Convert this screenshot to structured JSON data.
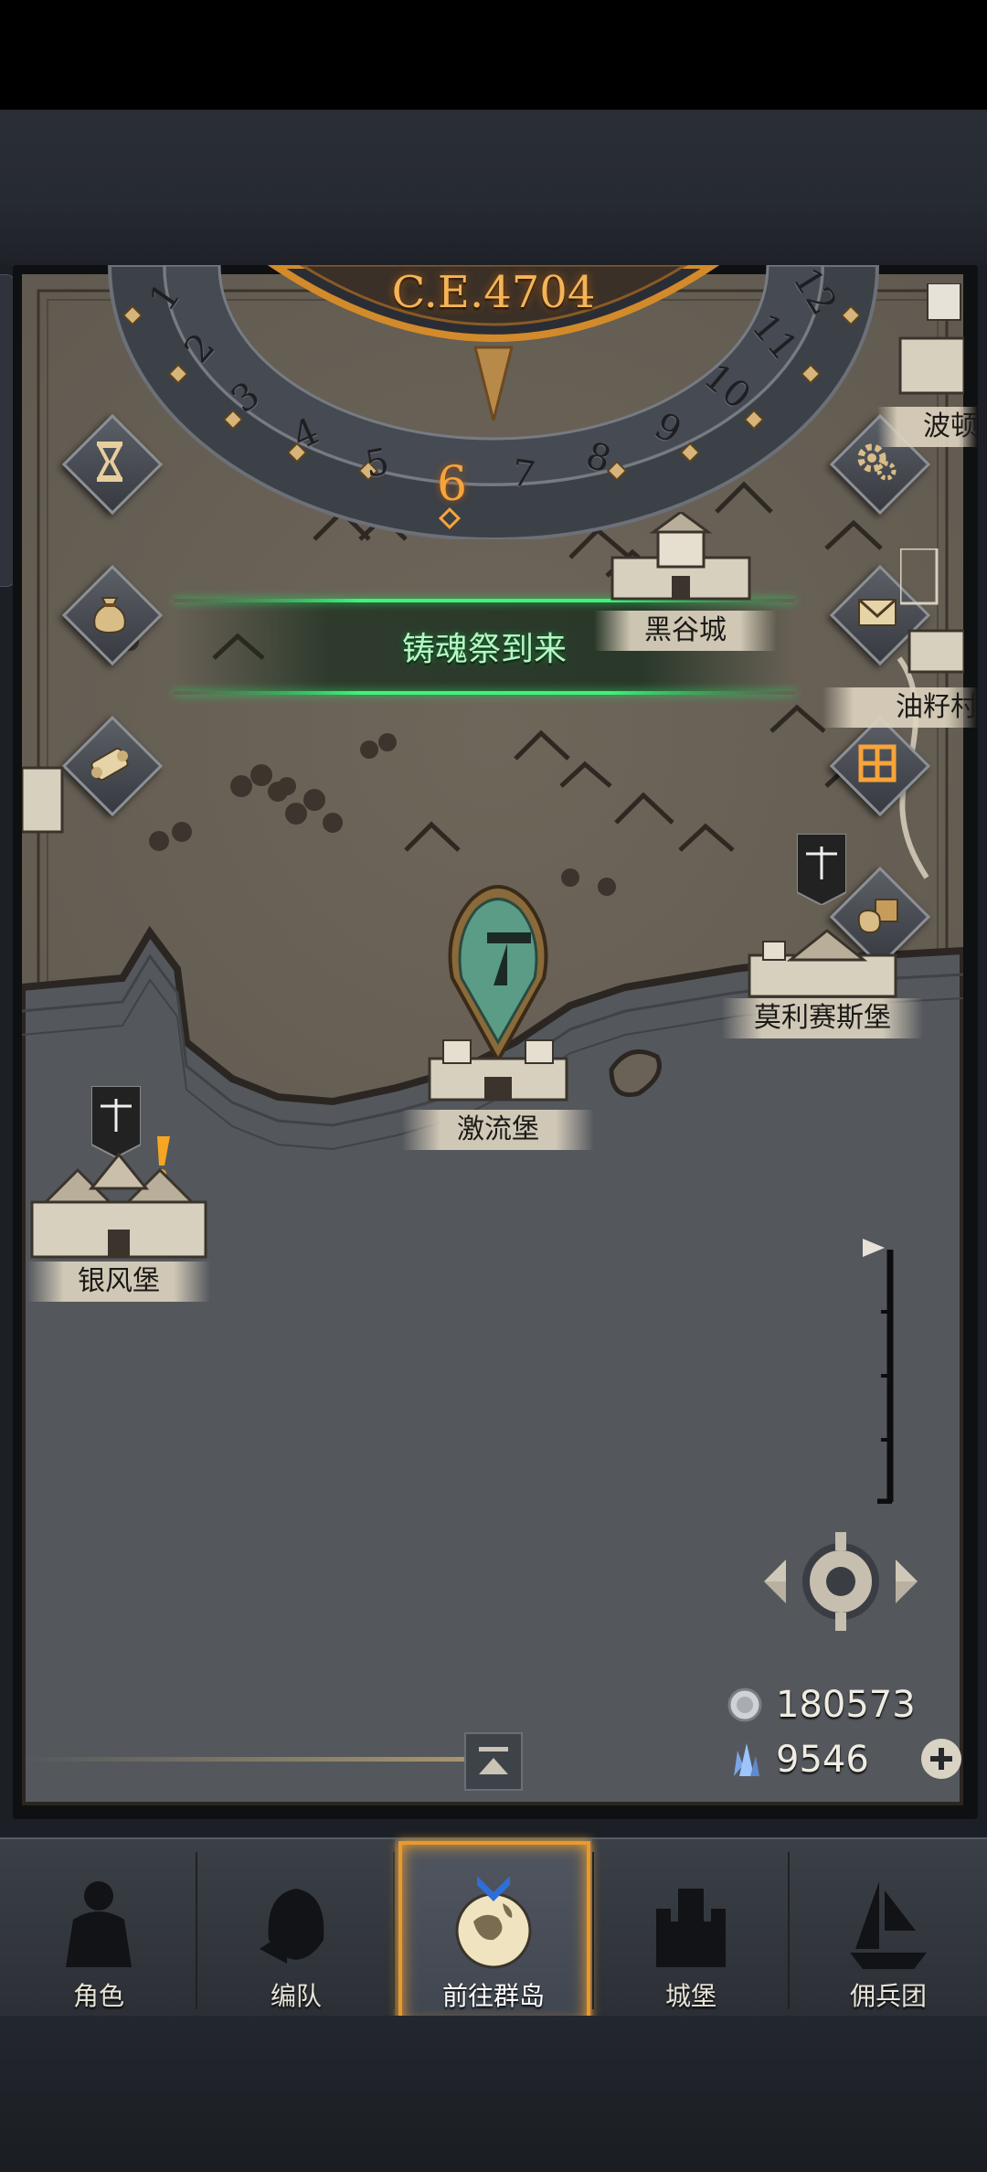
{
  "dial": {
    "year": "C.E.4704",
    "numbers": [
      "1",
      "2",
      "3",
      "4",
      "5",
      "6",
      "7",
      "8",
      "9",
      "10",
      "11",
      "12"
    ],
    "current": "6"
  },
  "event_banner": "铸魂祭到来",
  "cities": {
    "heigu": "黑谷城",
    "bodun": "波顿",
    "youzi": "油籽村",
    "molisaisi": "莫利赛斯堡",
    "jiliu": "激流堡",
    "yinfeng": "银风堡"
  },
  "side_buttons": {
    "left": [
      "hourglass-icon",
      "bag-icon",
      "scroll-icon"
    ],
    "right": [
      "gear-icon",
      "mail-icon",
      "grid-icon",
      "trade-icon"
    ]
  },
  "currency": {
    "silver": "180573",
    "crystal": "9546"
  },
  "nav": {
    "items": [
      {
        "label": "角色",
        "icon": "knight-icon"
      },
      {
        "label": "编队",
        "icon": "helmet-icon"
      },
      {
        "label": "前往群岛",
        "icon": "globe-icon"
      },
      {
        "label": "城堡",
        "icon": "castle-icon"
      },
      {
        "label": "佣兵团",
        "icon": "ship-icon"
      }
    ],
    "active_index": 2
  },
  "colors": {
    "accent_orange": "#f4a23a",
    "banner_green": "#3cf57a",
    "map_base": "#6a6256"
  }
}
